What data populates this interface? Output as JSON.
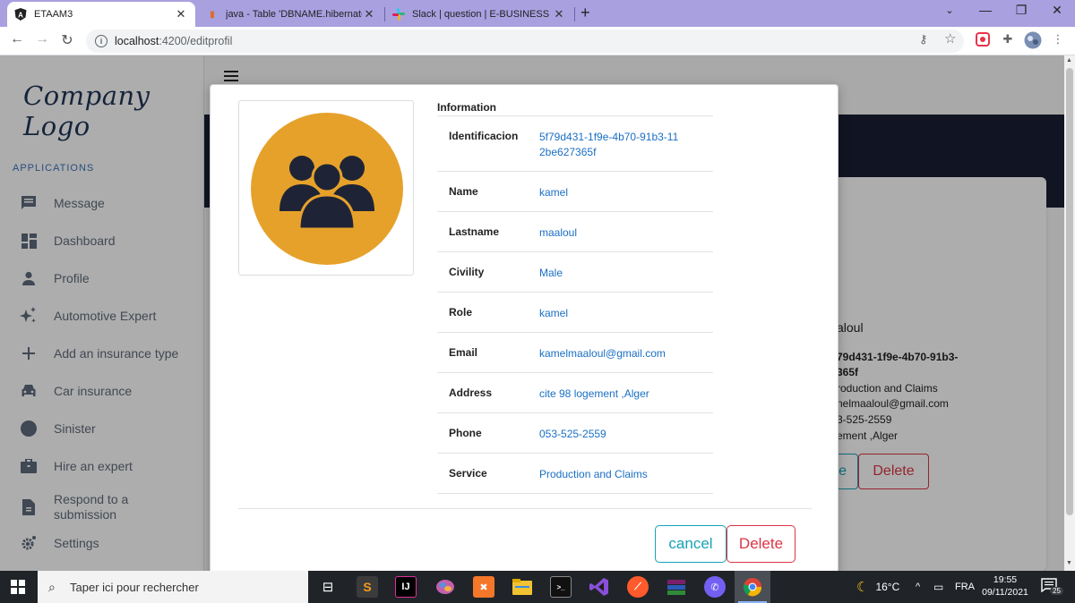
{
  "browser": {
    "tabs": [
      {
        "title": "ETAAM3",
        "favicon": "angular-icon"
      },
      {
        "title": "java - Table 'DBNAME.hibernate_",
        "favicon": "stackoverflow-icon"
      },
      {
        "title": "Slack | question | E-BUSINESS",
        "favicon": "slack-icon"
      }
    ],
    "url_host": "localhost",
    "url_path": ":4200/editprofil"
  },
  "sidebar": {
    "logo": "Company Logo",
    "section_title": "APPLICATIONS",
    "items": [
      {
        "label": "Message",
        "icon": "message-icon"
      },
      {
        "label": "Dashboard",
        "icon": "dashboard-icon"
      },
      {
        "label": "Profile",
        "icon": "person-icon"
      },
      {
        "label": "Automotive Expert",
        "icon": "sparkle-icon"
      },
      {
        "label": "Add an insurance type",
        "icon": "plus-icon"
      },
      {
        "label": "Car insurance",
        "icon": "car-icon"
      },
      {
        "label": "Sinister",
        "icon": "circle-icon"
      },
      {
        "label": "Hire an expert",
        "icon": "briefcase-icon"
      },
      {
        "label": "Respond to a submission",
        "icon": "document-icon"
      },
      {
        "label": "Settings",
        "icon": "gear-icon"
      }
    ]
  },
  "background_card": {
    "lines": [
      "aloul",
      "79d431-1f9e-4b70-91b3-",
      "365f",
      "roduction and Claims",
      "nelmaaloul@gmail.com",
      "3-525-2559",
      "ement ,Alger"
    ],
    "btn_left": "e",
    "btn_delete": "Delete"
  },
  "modal": {
    "info_title": "Information",
    "rows": [
      {
        "key": "Identificacion",
        "value": "5f79d431-1f9e-4b70-91b3-112be627365f"
      },
      {
        "key": "Name",
        "value": "kamel"
      },
      {
        "key": "Lastname",
        "value": "maaloul"
      },
      {
        "key": "Civility",
        "value": "Male"
      },
      {
        "key": "Role",
        "value": "kamel"
      },
      {
        "key": "Email",
        "value": "kamelmaaloul@gmail.com"
      },
      {
        "key": "Address",
        "value": "cite 98 logement ,Alger"
      },
      {
        "key": "Phone",
        "value": "053-525-2559"
      },
      {
        "key": "Service",
        "value": "Production and Claims"
      }
    ],
    "cancel_label": "cancel",
    "delete_label": "Delete"
  },
  "taskbar": {
    "search_placeholder": "Taper ici pour rechercher",
    "weather": "16°C",
    "language": "FRA",
    "time": "19:55",
    "date": "09/11/2021",
    "notification_count": "25"
  },
  "colors": {
    "tabstrip": "#a9a0e0",
    "accent_blue": "#1a6fc4",
    "cancel": "#17a2b8",
    "delete": "#dc3545",
    "avatar_bg": "#e6a12b",
    "dark_band": "#1a2034"
  }
}
